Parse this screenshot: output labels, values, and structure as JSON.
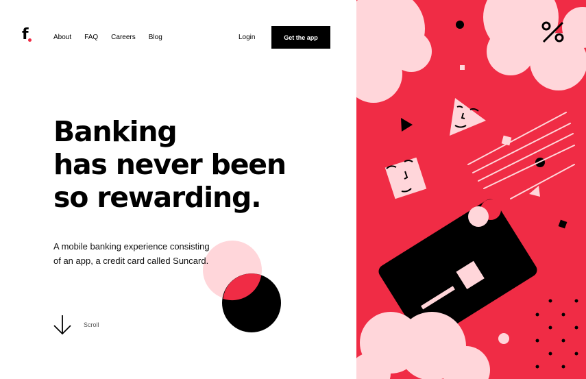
{
  "brand": {
    "logo_text": "f",
    "accent": "#f02c45"
  },
  "nav": {
    "items": [
      {
        "label": "About"
      },
      {
        "label": "FAQ"
      },
      {
        "label": "Careers"
      },
      {
        "label": "Blog"
      }
    ],
    "login_label": "Login",
    "cta_label": "Get the app"
  },
  "hero": {
    "headline_lines": [
      "Banking",
      "has never been",
      "so rewarding."
    ],
    "description_lines": [
      "A mobile banking experience consisting",
      "of an app, a credit card called Suncard."
    ],
    "scroll_label": "Scroll"
  },
  "illustration": {
    "percent_symbol": "%",
    "colors": {
      "background": "#f02c45",
      "cloud": "#ffd6da",
      "card": "#000000"
    }
  }
}
